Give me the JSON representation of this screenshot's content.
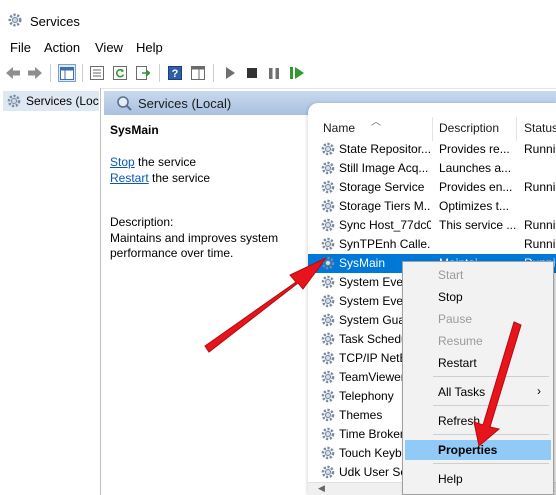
{
  "window": {
    "title": "Services"
  },
  "menu": [
    "File",
    "Action",
    "View",
    "Help"
  ],
  "tree": {
    "node_label": "Services (Loca"
  },
  "header": {
    "title": "Services (Local)"
  },
  "details": {
    "service_name": "SysMain",
    "stop_link": "Stop",
    "stop_rest": " the service",
    "restart_link": "Restart",
    "restart_rest": " the service",
    "description_label": "Description:",
    "description_text": "Maintains and improves system performance over time."
  },
  "columns": {
    "name": "Name",
    "description": "Description",
    "status": "Status"
  },
  "services": [
    {
      "name": "State Repositor...",
      "description": "Provides re...",
      "status": "Runni"
    },
    {
      "name": "Still Image Acq...",
      "description": "Launches a...",
      "status": ""
    },
    {
      "name": "Storage Service",
      "description": "Provides en...",
      "status": "Runni"
    },
    {
      "name": "Storage Tiers M...",
      "description": "Optimizes t...",
      "status": ""
    },
    {
      "name": "Sync Host_77dc0",
      "description": "This service ...",
      "status": "Runni"
    },
    {
      "name": "SynTPEnh Calle...",
      "description": "",
      "status": "Runni"
    },
    {
      "name": "SysMain",
      "description": "Maintai...",
      "status": "Runni"
    },
    {
      "name": "System Ever",
      "description": "",
      "status": ""
    },
    {
      "name": "System Ever",
      "description": "",
      "status": ""
    },
    {
      "name": "System Guar",
      "description": "",
      "status": ""
    },
    {
      "name": "Task Schedu",
      "description": "",
      "status": ""
    },
    {
      "name": "TCP/IP NetB",
      "description": "",
      "status": ""
    },
    {
      "name": "TeamViewer",
      "description": "",
      "status": ""
    },
    {
      "name": "Telephony",
      "description": "",
      "status": ""
    },
    {
      "name": "Themes",
      "description": "",
      "status": ""
    },
    {
      "name": "Time Broker",
      "description": "",
      "status": ""
    },
    {
      "name": "Touch Keybo",
      "description": "",
      "status": ""
    },
    {
      "name": "Udk User Se",
      "description": "",
      "status": ""
    }
  ],
  "context_menu": {
    "start": "Start",
    "stop": "Stop",
    "pause": "Pause",
    "resume": "Resume",
    "restart": "Restart",
    "all_tasks": "All Tasks",
    "refresh": "Refresh",
    "properties": "Properties",
    "help": "Help",
    "submenu_indicator": "›"
  },
  "colors": {
    "selection": "#0078d7",
    "menu_highlight": "#91c9f7",
    "arrow": "#e8141b",
    "link": "#0a57b5"
  }
}
